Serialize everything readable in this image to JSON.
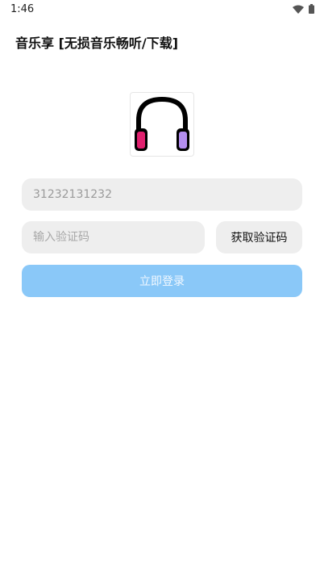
{
  "status_bar": {
    "time": "1:46",
    "icons": [
      "wifi-icon",
      "battery-icon"
    ]
  },
  "app": {
    "title": "音乐享 [无损音乐畅听/下载]"
  },
  "logo": {
    "icon": "headphones-icon",
    "colors": {
      "left_cup": "#e0206e",
      "right_cup": "#b48ef0",
      "outline": "#000000"
    }
  },
  "form": {
    "phone_value": "31232131232",
    "code_placeholder": "输入验证码",
    "get_code_label": "获取验证码",
    "login_label": "立即登录"
  },
  "colors": {
    "field_bg": "#eeeeee",
    "login_button": "#8ac8f8"
  }
}
